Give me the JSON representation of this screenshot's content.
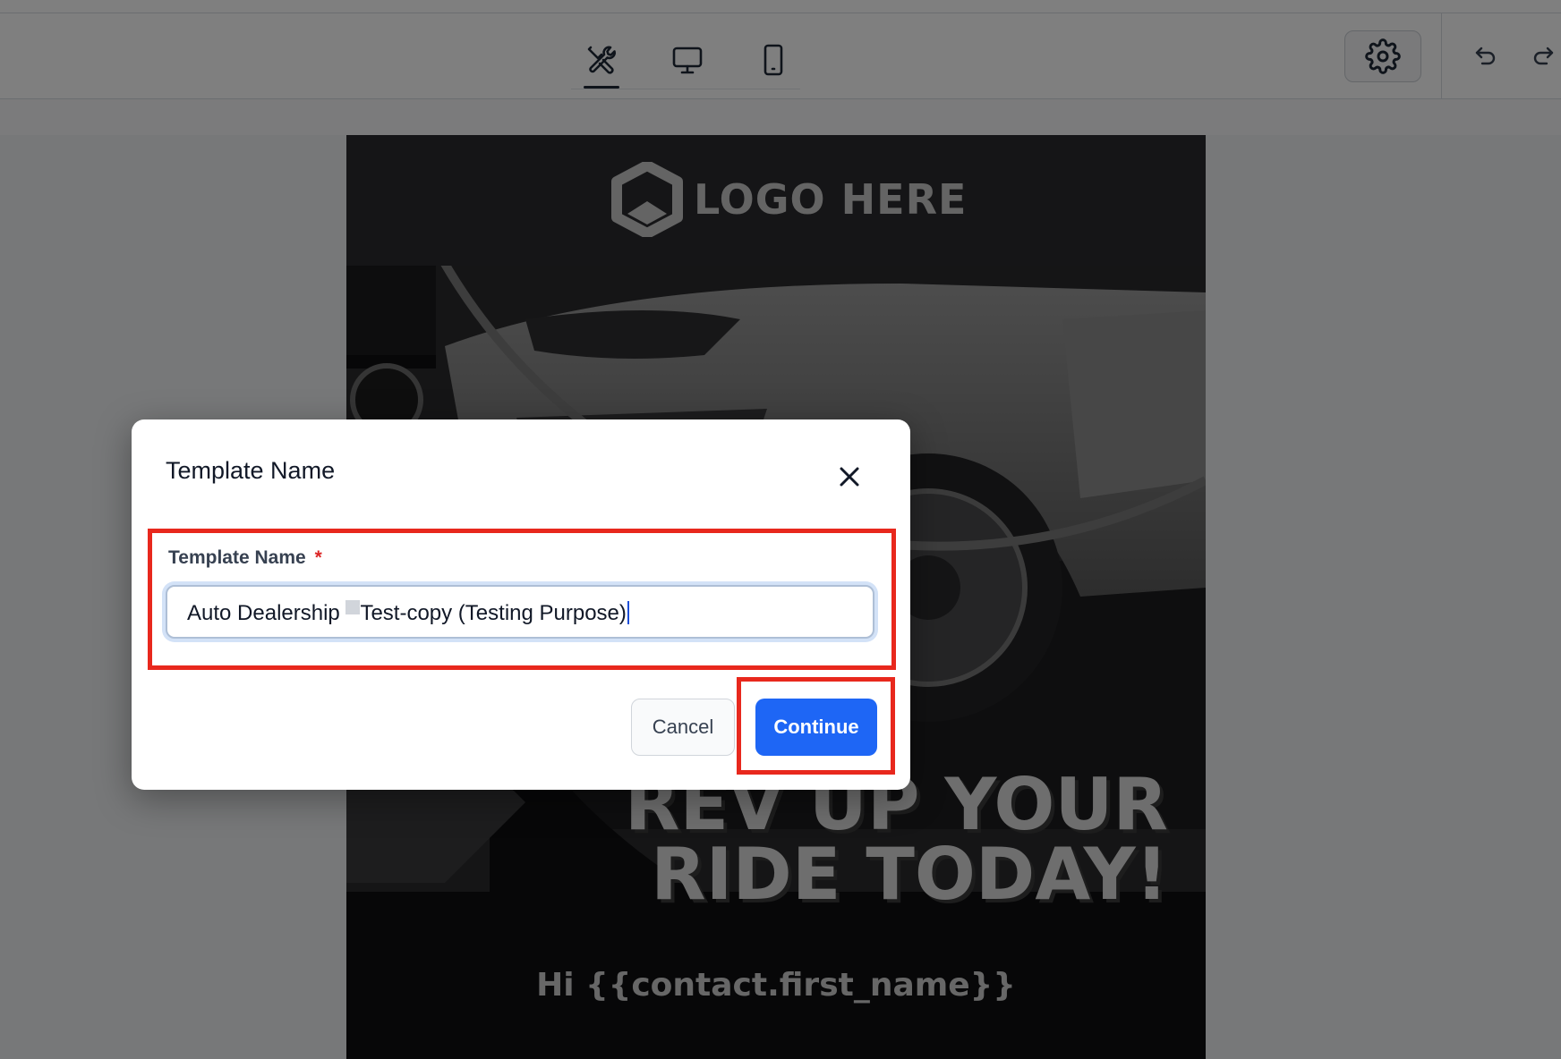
{
  "toolbar": {
    "view_tabs": [
      {
        "name": "tools-icon",
        "active": true
      },
      {
        "name": "desktop-icon",
        "active": false
      },
      {
        "name": "mobile-icon",
        "active": false
      }
    ],
    "settings_icon": "gear-icon",
    "undo_icon": "undo-icon",
    "redo_icon": "redo-icon"
  },
  "email": {
    "logo_text": "LOGO HERE",
    "headline_line1": "REV UP YOUR",
    "headline_line2": "RIDE TODAY!",
    "greeting": "Hi {{contact.first_name}}"
  },
  "modal": {
    "title": "Template Name",
    "field_label": "Template Name",
    "required_mark": "*",
    "input_value_start": "Auto Dealership ",
    "input_value_end": "Test-copy (Testing Purpose)",
    "cancel_label": "Cancel",
    "continue_label": "Continue"
  },
  "colors": {
    "primary": "#1e66f5",
    "highlight": "#e8281d",
    "required": "#dc2626"
  }
}
